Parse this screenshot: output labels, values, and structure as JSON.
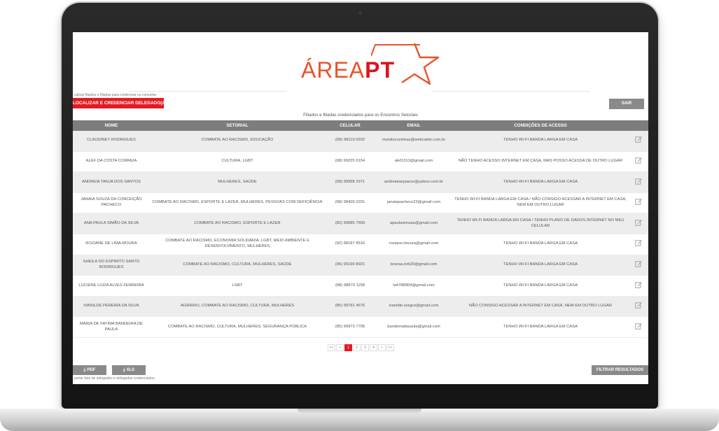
{
  "brand": {
    "logo_prefix": "ÁREA",
    "logo_suffix": "PT",
    "colors": {
      "red": "#e31b23",
      "orange": "#e8532a",
      "header_grey": "#7d7d7d"
    }
  },
  "top": {
    "hint": "calizar filiados e filiadas para credenciar ou consultar",
    "locate_button": "LOCALIZAR E CREDENCIAR DELEGADO(A)",
    "logout_button": "SAIR",
    "table_title": "Filiados e filiadas credenciados para os Encontros Setoriais"
  },
  "table": {
    "columns": [
      "NOME",
      "SETORIAL",
      "CELULAR",
      "EMAIL",
      "CONDIÇÕES DE ACESSO",
      ""
    ],
    "rows": [
      {
        "nome": "CLAUDINEY RODRIGUES",
        "setorial": "COMBATE AO RACISMO, EDUCAÇÃO",
        "celular": "(68) 98119 0202",
        "email": "mundocozinhas@webcable.com.br",
        "acesso": "TENHO WI-FI BANDA LARGA EM CASA"
      },
      {
        "nome": "ALEF DA COSTA CORREIA",
        "setorial": "CULTURA, LGBT",
        "celular": "(68) 99225 0154",
        "email": "alef1313@gmail.com",
        "acesso": "NÃO TENHO ACESSO INTERNET EM CASA, MAS POSSO ACESSA DE OUTRO LUGAR"
      },
      {
        "nome": "ANDREIA TANJA DOS SANTOS",
        "setorial": "MULHERES, SAÚDE",
        "celular": "(68) 99998 2971",
        "email": "andreiatanjaacre@yahoo.com.br",
        "acesso": "TENHO WI-FI BANDA LARGA EM CASA"
      },
      {
        "nome": "JANAIA SOUZA DA CONCEIÇÃO PACHECO",
        "setorial": "COMBATE AO RACISMO, ESPORTE E LAZER, MULHERES, PESSOAS COM DEFICIÊNCIA",
        "celular": "(68) 98409 2291",
        "email": "janaiapacheco23@gmail.com",
        "acesso": "TENHO WI-FI BANDA LARGA EM CASA / NÃO CONSIGO ACESSAR A INTERNET EM CASA, NEM EM OUTRO LUGAR"
      },
      {
        "nome": "ANA PAULA SIMÃO DA SILVA",
        "setorial": "COMBATE AO RACISMO, ESPORTE E LAZER",
        "celular": "(82) 99685 7659",
        "email": "apaulasimaao@gmail.com",
        "acesso": "TENHO WI-FI BANDA LARGA EM CASA / TENHO PLANO DE DADOS INTERNET NO MEU CELULAR"
      },
      {
        "nome": "ROZIANE DE LIMA MOURA",
        "setorial": "COMBATE AO RACISMO, ECONOMIA SOLIDÁRIA, LGBT, MEIO AMBIENTE E DESENVOLVIMENTO, MULHERES",
        "celular": "(92) 98187 8516",
        "email": "roziane.lmoura@gmail.com",
        "acesso": "TENHO WI-FI BANDA LARGA EM CASA"
      },
      {
        "nome": "SHEILA DO ESPIRITO SANTO RODRIGUES",
        "setorial": "COMBATE AO RACISMO, CULTURA, MULHERES, SAÚDE",
        "celular": "(96) 99190 8921",
        "email": "brunaa.brb20@gmail.com",
        "acesso": "TENHO WI-FI BANDA LARGA EM CASA"
      },
      {
        "nome": "LUCIENE LUIZA ALVES FERREIRA",
        "setorial": "LGBT",
        "celular": "(88) 98879 1158",
        "email": "la4788904@gmail.com",
        "acesso": "TENHO WI-FI BANDA LARGA EM CASA"
      },
      {
        "nome": "IVANILDE PEREIRA DA SILVA",
        "setorial": "AGRÁRIO, COMBATE AO RACISMO, CULTURA, MULHERES",
        "celular": "(85) 99791 4676",
        "email": "ivanilde.sorgce@gmail.com",
        "acesso": "NÃO CONSIGO ACESSAR A INTERNET EM CASA, NEM EM OUTRO LUGAR"
      },
      {
        "nome": "MARIA DE FATIMA BANDEIRA DE PAULA",
        "setorial": "COMBATE AO RACISMO, CULTURA, MULHERES, SEGURANÇA PÚBLICA",
        "celular": "(85) 99973 7705",
        "email": "bandeiradepaula@gmail.com",
        "acesso": "TENHO WI-FI BANDA LARGA EM CASA"
      }
    ],
    "edit_icon": "edit-icon"
  },
  "pagination": {
    "first": "<<",
    "prev": "<",
    "pages": [
      "1",
      "2",
      "3",
      "4"
    ],
    "current": "1",
    "next": ">",
    "last": ">>"
  },
  "bottom": {
    "pdf_button": "PDF",
    "xls_button": "XLS",
    "export_hint": "portar lista de delegados e delegadas credenciados.",
    "filter_button": "FILTRAR RESULTADOS"
  }
}
